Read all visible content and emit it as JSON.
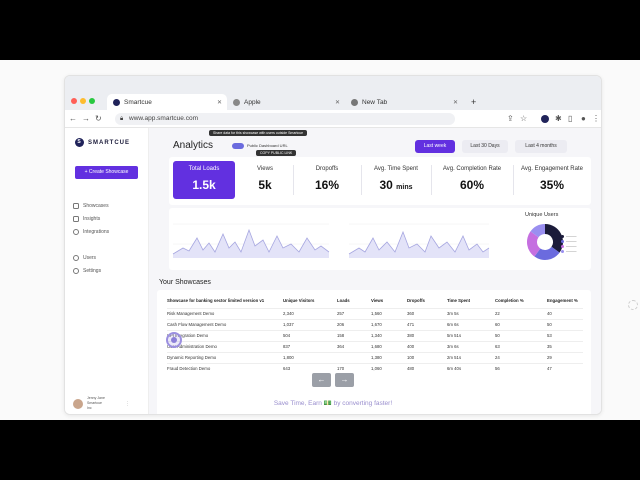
{
  "browser": {
    "tabs": [
      {
        "label": "Smartcue",
        "favicon_color": "#20235a"
      },
      {
        "label": "Apple",
        "favicon_color": "#888888"
      },
      {
        "label": "New Tab",
        "favicon_color": "#777777"
      }
    ],
    "new_tab": "+",
    "url": "www.app.smartcue.com",
    "progress_fraction": 0.14
  },
  "sidebar": {
    "logo": "SMARTCUE",
    "create_button": "+ Create Showcase",
    "items": [
      {
        "label": "Showcases",
        "icon": "play-icon"
      },
      {
        "label": "Insights",
        "icon": "chart-icon"
      },
      {
        "label": "Integrations",
        "icon": "plug-icon"
      },
      {
        "label": "Users",
        "icon": "users-icon"
      },
      {
        "label": "Settings",
        "icon": "gear-icon"
      }
    ],
    "user": {
      "name": "Jenny Jane",
      "line2": "Smartcue",
      "line3": "Inc"
    }
  },
  "header": {
    "title": "Analytics",
    "toggle_label": "Public Dashboard URL",
    "tooltip_top": "Share data for this showcase with users outside Smartcue",
    "tooltip_bottom": "COPY PUBLIC LINK",
    "ranges": [
      "Last week",
      "Last 30 Days",
      "Last 4 months"
    ],
    "active_range": 0
  },
  "stats": [
    {
      "label": "Total Loads",
      "value": "1.5k",
      "unit": ""
    },
    {
      "label": "Views",
      "value": "5k",
      "unit": ""
    },
    {
      "label": "Dropoffs",
      "value": "16%",
      "unit": ""
    },
    {
      "label": "Avg. Time Spent",
      "value": "30",
      "unit": "mins"
    },
    {
      "label": "Avg. Completion Rate",
      "value": "60%",
      "unit": ""
    },
    {
      "label": "Avg. Engagement Rate",
      "value": "35%",
      "unit": ""
    }
  ],
  "donut": {
    "title": "Unique Users",
    "colors": [
      "#1b1b3a",
      "#6b6bde",
      "#c56fe0",
      "#9a8ff0"
    ],
    "fractions": [
      0.35,
      0.25,
      0.25,
      0.15
    ]
  },
  "showcases": {
    "title": "Your Showcases",
    "columns": [
      "Showcase for banking sector limited version v1",
      "Unique Visitors",
      "Loads",
      "Views",
      "Dropoffs",
      "Time Spent",
      "Completion %",
      "Engagement %"
    ],
    "rows": [
      [
        "Risk Management Demo",
        "2,340",
        "257",
        "1,560",
        "360",
        "3m 5s",
        "22",
        "40"
      ],
      [
        "Cash Flow Management Demo",
        "1,037",
        "206",
        "1,670",
        "471",
        "6m 6s",
        "60",
        "50"
      ],
      [
        "KPI Integration Demo",
        "504",
        "158",
        "1,340",
        "380",
        "5m 51s",
        "50",
        "53"
      ],
      [
        "User Administration Demo",
        "837",
        "364",
        "1,680",
        "400",
        "3m 6s",
        "63",
        "35"
      ],
      [
        "Dynamic Reporting Demo",
        "1,800",
        "",
        "1,380",
        "100",
        "2m 51s",
        "24",
        "29"
      ],
      [
        "Fraud Detection Demo",
        "643",
        "170",
        "1,060",
        "480",
        "6m 40s",
        "56",
        "47"
      ]
    ]
  },
  "pager": {
    "prev": "←",
    "next": "→"
  },
  "footer": "Save Time, Earn 💵 by converting faster!",
  "accent": "#6230e0"
}
